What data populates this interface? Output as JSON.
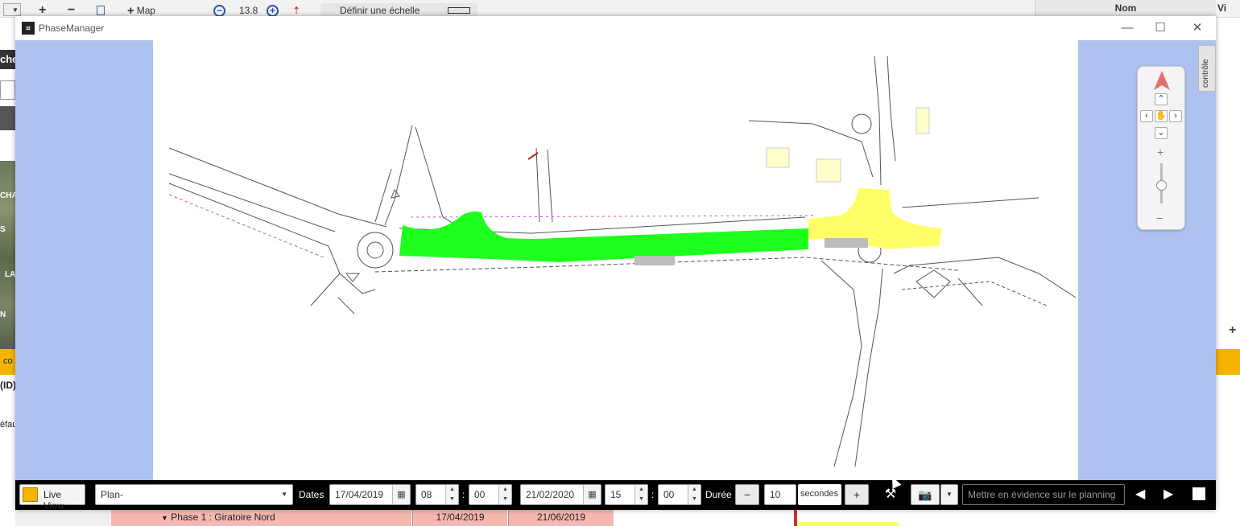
{
  "background_app": {
    "toolbar": {
      "add_symbol": "+",
      "remove_symbol": "−",
      "map_label": "Map",
      "zoom_value": "13.8",
      "scale_label": "Définir une échelle"
    },
    "right_header": "Nom",
    "right_header_2": "Vi",
    "left_fragments": [
      "che",
      "CHA",
      "S",
      "LA",
      "N",
      "co",
      "(ID)",
      "éfau"
    ]
  },
  "window": {
    "title": "PhaseManager",
    "controls": {
      "minimize": "—",
      "maximize": "☐",
      "close": "✕"
    },
    "side_tab_label": "contrôle",
    "map": {
      "labels": []
    },
    "toolbar": {
      "live_view_label": "Live View",
      "plan_value": "Plan-",
      "dates_label": "Dates",
      "start_date": "17/04/2019",
      "start_hour": "08",
      "start_minute": "00",
      "end_date": "21/02/2020",
      "end_hour": "15",
      "end_minute": "00",
      "time_separator": ":",
      "duration_label": "Durée",
      "duration_value": "10",
      "duration_unit": "secondes",
      "minus_symbol": "−",
      "plus_symbol": "+",
      "highlight_placeholder": "Mettre en évidence sur le planning"
    }
  },
  "gantt_row": {
    "phase_label": "Phase 1 : Giratoire Nord",
    "start": "17/04/2019",
    "end": "21/06/2019"
  },
  "colors": {
    "map_side": "#aec2f0",
    "phase_green": "#1eff1e",
    "phase_yellow": "#ffff66",
    "toolbar_bg": "#000000",
    "gantt_row": "#f5b8b0",
    "orange_banner": "#f5b400"
  }
}
